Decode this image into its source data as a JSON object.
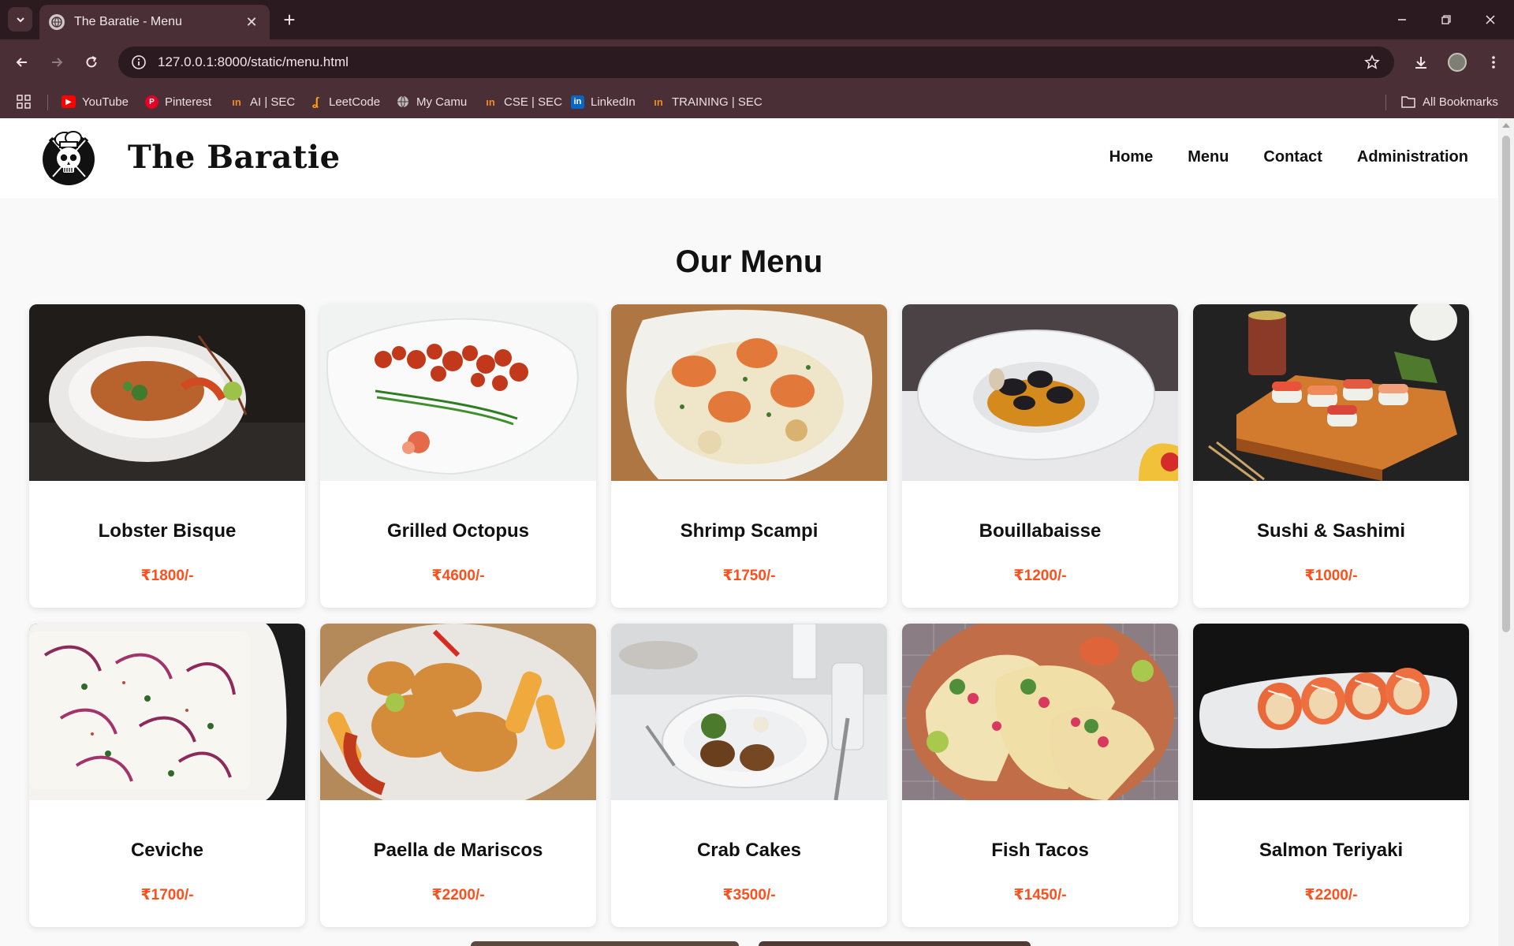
{
  "browser": {
    "tab_title": "The Baratie - Menu",
    "url": "127.0.0.1:8000/static/menu.html",
    "bookmarks": [
      {
        "label": "YouTube",
        "icon": "youtube-icon",
        "color": "#ff0000"
      },
      {
        "label": "Pinterest",
        "icon": "pinterest-icon",
        "color": "#e60023"
      },
      {
        "label": "AI | SEC",
        "icon": "camu-icon",
        "color": "#f08a24"
      },
      {
        "label": "LeetCode",
        "icon": "leetcode-icon",
        "color": "#ffa116"
      },
      {
        "label": "My Camu",
        "icon": "globe-icon",
        "color": "#bdbdbd"
      },
      {
        "label": "CSE | SEC",
        "icon": "camu-icon",
        "color": "#f08a24"
      },
      {
        "label": "LinkedIn",
        "icon": "linkedin-icon",
        "color": "#0a66c2"
      },
      {
        "label": "TRAINING | SEC",
        "icon": "camu-icon",
        "color": "#f08a24"
      }
    ],
    "all_bookmarks": "All Bookmarks"
  },
  "site": {
    "brand": "The Baratie",
    "nav": [
      "Home",
      "Menu",
      "Contact",
      "Administration"
    ]
  },
  "page": {
    "title": "Our Menu"
  },
  "menu_items": [
    {
      "name": "Lobster Bisque",
      "price": "₹1800/-",
      "icon": "soup-bowl-image"
    },
    {
      "name": "Grilled Octopus",
      "price": "₹4600/-",
      "icon": "octopus-plate-image"
    },
    {
      "name": "Shrimp Scampi",
      "price": "₹1750/-",
      "icon": "shrimp-dish-image"
    },
    {
      "name": "Bouillabaisse",
      "price": "₹1200/-",
      "icon": "mussel-stew-image"
    },
    {
      "name": "Sushi & Sashimi",
      "price": "₹1000/-",
      "icon": "sushi-board-image"
    },
    {
      "name": "Ceviche",
      "price": "₹1700/-",
      "icon": "ceviche-dish-image"
    },
    {
      "name": "Paella de Mariscos",
      "price": "₹2200/-",
      "icon": "fried-seafood-image"
    },
    {
      "name": "Crab Cakes",
      "price": "₹3500/-",
      "icon": "crab-cakes-image"
    },
    {
      "name": "Fish Tacos",
      "price": "₹1450/-",
      "icon": "tacos-image"
    },
    {
      "name": "Salmon Teriyaki",
      "price": "₹2200/-",
      "icon": "salmon-rolls-image"
    }
  ],
  "colors": {
    "price": "#ff4f1c",
    "chrome_dark": "#2b1a20",
    "chrome_mid": "#4a2f37"
  }
}
